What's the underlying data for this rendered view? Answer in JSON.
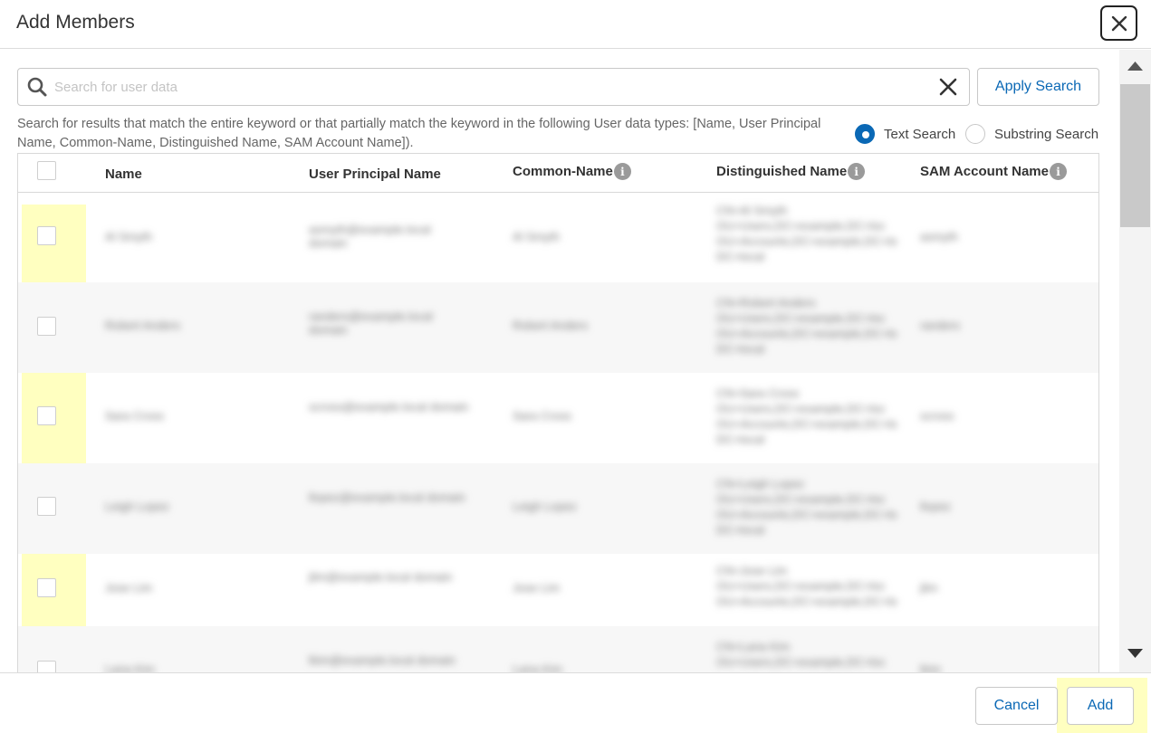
{
  "dialog": {
    "title": "Add Members",
    "close_icon": "close-icon"
  },
  "search": {
    "placeholder": "Search for user data",
    "value": "",
    "apply_label": "Apply Search",
    "help_text": "Search for results that match the entire keyword or that partially match the keyword in the following User data types: [Name, User Principal Name, Common-Name, Distinguished Name, SAM Account Name]).",
    "options": [
      {
        "label": "Text Search",
        "selected": true
      },
      {
        "label": "Substring Search",
        "selected": false
      }
    ]
  },
  "table": {
    "columns": [
      {
        "label": "Name",
        "info": false
      },
      {
        "label": "User Principal Name",
        "info": false
      },
      {
        "label": "Common-Name",
        "info": true
      },
      {
        "label": "Distinguished Name",
        "info": true
      },
      {
        "label": "SAM Account Name",
        "info": true
      }
    ],
    "info_glyph": "i",
    "rows": [
      {
        "name": "Al Smyth",
        "upn": "asmyth@example.local domain",
        "cn": "Al Smyth",
        "dn": [
          "CN=Al Smyth",
          "OU=Users,DC=example,DC=loc",
          "OU=Accounts,DC=example,DC=lo",
          "DC=local"
        ],
        "sam": "asmyth"
      },
      {
        "name": "Robert Anders",
        "upn": "randers@example.local domain",
        "cn": "Robert Anders",
        "dn": [
          "CN=Robert Anders",
          "OU=Users,DC=example,DC=loc",
          "OU=Accounts,DC=example,DC=lo",
          "DC=local"
        ],
        "sam": "randers"
      },
      {
        "name": "Sara Cross",
        "upn": "scross@example.local domain",
        "cn": "Sara Cross",
        "dn": [
          "CN=Sara Cross",
          "OU=Users,DC=example,DC=loc",
          "OU=Accounts,DC=example,DC=lo",
          "DC=local"
        ],
        "sam": "scross"
      },
      {
        "name": "Leigh Lopez",
        "upn": "llopez@example.local domain",
        "cn": "Leigh Lopez",
        "dn": [
          "CN=Leigh Lopez",
          "OU=Users,DC=example,DC=loc",
          "OU=Accounts,DC=example,DC=lo",
          "DC=local"
        ],
        "sam": "llopez"
      },
      {
        "name": "Jose Lim",
        "upn": "jlim@example.local domain",
        "cn": "Jose Lim",
        "dn": [
          "CN=Jose Lim",
          "OU=Users,DC=example,DC=loc",
          "OU=Accounts,DC=example,DC=lo"
        ],
        "sam": "jlim"
      },
      {
        "name": "Lana Kim",
        "upn": "lkim@example.local domain",
        "cn": "Lana Kim",
        "dn": [
          "CN=Lana Kim",
          "OU=Users,DC=example,DC=loc"
        ],
        "sam": "lkim"
      }
    ]
  },
  "footer": {
    "cancel_label": "Cancel",
    "add_label": "Add"
  },
  "colors": {
    "accent": "#0a68b5",
    "highlight": "#ffffc0"
  }
}
